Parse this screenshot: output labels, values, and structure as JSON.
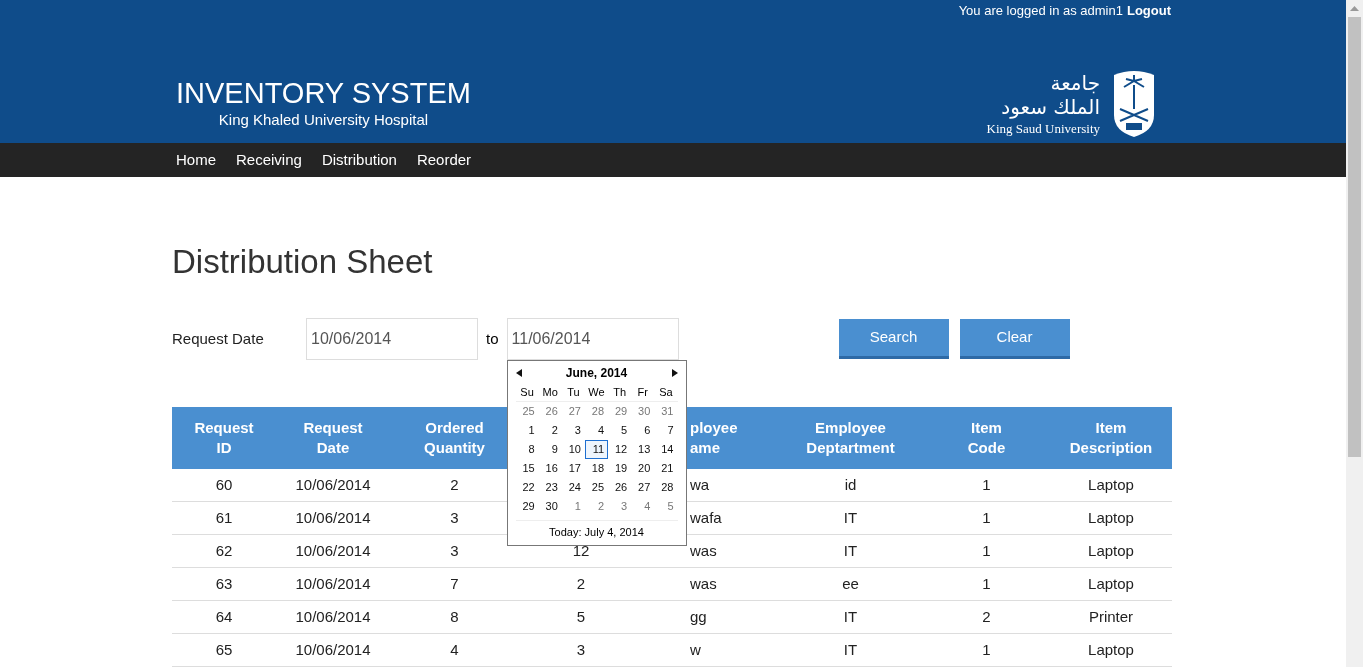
{
  "user_bar": {
    "text": "You are logged in as admin1",
    "logout": "Logout"
  },
  "brand": {
    "title": "INVENTORY SYSTEM",
    "subtitle": "King Khaled University Hospital"
  },
  "university_logo": {
    "arabic_lines": [
      "جامعة",
      "الملك سعود"
    ],
    "english": "King Saud University"
  },
  "nav": [
    {
      "label": "Home"
    },
    {
      "label": "Receiving"
    },
    {
      "label": "Distribution"
    },
    {
      "label": "Reorder"
    }
  ],
  "page_title": "Distribution Sheet",
  "filter": {
    "label": "Request Date",
    "from": "10/06/2014",
    "separator": "to",
    "to": "11/06/2014",
    "buttons": [
      "Search",
      "Clear"
    ]
  },
  "calendar": {
    "month": "June, 2014",
    "weekdays": [
      "Su",
      "Mo",
      "Tu",
      "We",
      "Th",
      "Fr",
      "Sa"
    ],
    "days": [
      {
        "label": "25",
        "other_month": true,
        "selected": false
      },
      {
        "label": "26",
        "other_month": true,
        "selected": false
      },
      {
        "label": "27",
        "other_month": true,
        "selected": false
      },
      {
        "label": "28",
        "other_month": true,
        "selected": false
      },
      {
        "label": "29",
        "other_month": true,
        "selected": false
      },
      {
        "label": "30",
        "other_month": true,
        "selected": false
      },
      {
        "label": "31",
        "other_month": true,
        "selected": false
      },
      {
        "label": "1",
        "other_month": false,
        "selected": false
      },
      {
        "label": "2",
        "other_month": false,
        "selected": false
      },
      {
        "label": "3",
        "other_month": false,
        "selected": false
      },
      {
        "label": "4",
        "other_month": false,
        "selected": false
      },
      {
        "label": "5",
        "other_month": false,
        "selected": false
      },
      {
        "label": "6",
        "other_month": false,
        "selected": false
      },
      {
        "label": "7",
        "other_month": false,
        "selected": false
      },
      {
        "label": "8",
        "other_month": false,
        "selected": false
      },
      {
        "label": "9",
        "other_month": false,
        "selected": false
      },
      {
        "label": "10",
        "other_month": false,
        "selected": false
      },
      {
        "label": "11",
        "other_month": false,
        "selected": true
      },
      {
        "label": "12",
        "other_month": false,
        "selected": false
      },
      {
        "label": "13",
        "other_month": false,
        "selected": false
      },
      {
        "label": "14",
        "other_month": false,
        "selected": false
      },
      {
        "label": "15",
        "other_month": false,
        "selected": false
      },
      {
        "label": "16",
        "other_month": false,
        "selected": false
      },
      {
        "label": "17",
        "other_month": false,
        "selected": false
      },
      {
        "label": "18",
        "other_month": false,
        "selected": false
      },
      {
        "label": "19",
        "other_month": false,
        "selected": false
      },
      {
        "label": "20",
        "other_month": false,
        "selected": false
      },
      {
        "label": "21",
        "other_month": false,
        "selected": false
      },
      {
        "label": "22",
        "other_month": false,
        "selected": false
      },
      {
        "label": "23",
        "other_month": false,
        "selected": false
      },
      {
        "label": "24",
        "other_month": false,
        "selected": false
      },
      {
        "label": "25",
        "other_month": false,
        "selected": false
      },
      {
        "label": "26",
        "other_month": false,
        "selected": false
      },
      {
        "label": "27",
        "other_month": false,
        "selected": false
      },
      {
        "label": "28",
        "other_month": false,
        "selected": false
      },
      {
        "label": "29",
        "other_month": false,
        "selected": false
      },
      {
        "label": "30",
        "other_month": false,
        "selected": false
      },
      {
        "label": "1",
        "other_month": true,
        "selected": false
      },
      {
        "label": "2",
        "other_month": true,
        "selected": false
      },
      {
        "label": "3",
        "other_month": true,
        "selected": false
      },
      {
        "label": "4",
        "other_month": true,
        "selected": false
      },
      {
        "label": "5",
        "other_month": true,
        "selected": false
      }
    ],
    "today": "Today: July 4, 2014"
  },
  "table": {
    "columns": [
      {
        "label": "Request ID"
      },
      {
        "label": "Request Date"
      },
      {
        "label": "Ordered Quantity"
      },
      {},
      {
        "label": "ployee ame"
      },
      {
        "label": "Employee Deptartment"
      },
      {
        "label": "Item Code"
      },
      {
        "label": "Item Description"
      }
    ],
    "rows": [
      [
        "60",
        "10/06/2014",
        "2",
        null,
        "wa",
        "id",
        "1",
        "Laptop"
      ],
      [
        "61",
        "10/06/2014",
        "3",
        null,
        "wafa",
        "IT",
        "1",
        "Laptop"
      ],
      [
        "62",
        "10/06/2014",
        "3",
        "12",
        "was",
        "IT",
        "1",
        "Laptop"
      ],
      [
        "63",
        "10/06/2014",
        "7",
        "2",
        "was",
        "ee",
        "1",
        "Laptop"
      ],
      [
        "64",
        "10/06/2014",
        "8",
        "5",
        "gg",
        "IT",
        "2",
        "Printer"
      ],
      [
        "65",
        "10/06/2014",
        "4",
        "3",
        "w",
        "IT",
        "1",
        "Laptop"
      ]
    ]
  }
}
